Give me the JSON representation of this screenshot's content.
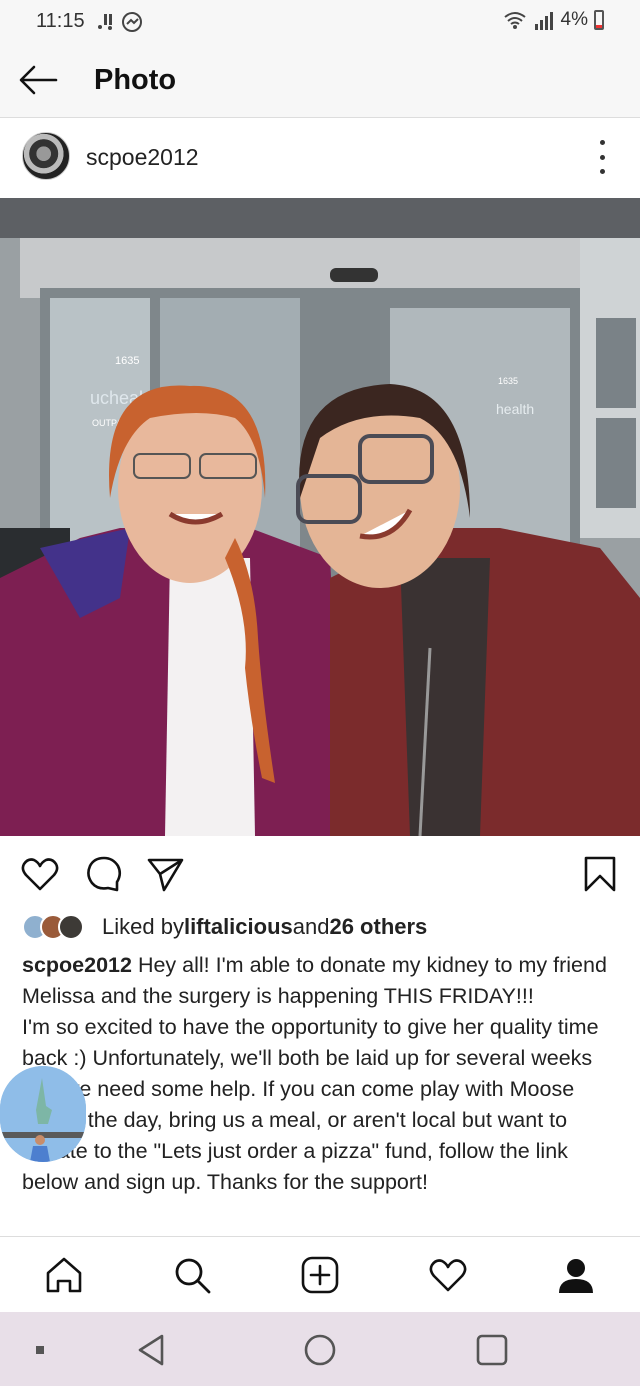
{
  "status_bar": {
    "time": "11:15",
    "notif_icons": "•!",
    "signal": "⋮❙❙",
    "battery": "4%"
  },
  "header": {
    "title": "Photo",
    "back_icon": "arrow-left-icon"
  },
  "post": {
    "username": "scpoe2012",
    "likes": {
      "prefix": "Liked by ",
      "user": "liftalicious",
      "middle": " and ",
      "others": "26 others"
    },
    "caption": {
      "username": "scpoe2012",
      "paragraph1": " Hey all! I'm able to donate my kidney to my friend Melissa and the surgery is happening THIS FRIDAY!!!",
      "paragraph2": "I'm so excited to have the opportunity to give her quality time back :) Unfortunately, we'll both be laid up for several weeks and we need some help. If you can come play with Moose during the day, bring us a meal, or aren't local but want to donate to the \"Lets just order a pizza\" fund, follow the link below and sign up. Thanks for the support!"
    },
    "photo_sign_text": [
      "1635",
      "ucheal",
      "health",
      "OUTPATI"
    ]
  },
  "icons": {
    "actions": [
      "heart-icon",
      "comment-icon",
      "share-icon",
      "bookmark-icon"
    ],
    "nav": [
      "home-icon",
      "search-icon",
      "add-icon",
      "activity-icon",
      "profile-icon"
    ],
    "system": [
      "recent-apps",
      "back-triangle",
      "home-circle",
      "overview-square"
    ]
  },
  "colors": {
    "accent": "#262626",
    "sys_nav_bg": "#e8dfe8",
    "battery_low": "#e33333"
  }
}
